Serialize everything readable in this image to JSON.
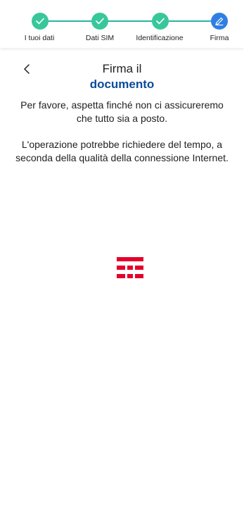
{
  "stepper": {
    "steps": [
      {
        "label": "I tuoi dati",
        "status": "completed",
        "icon": "check-icon"
      },
      {
        "label": "Dati SIM",
        "status": "completed",
        "icon": "check-icon"
      },
      {
        "label": "Identificazione",
        "status": "completed",
        "icon": "check-icon"
      },
      {
        "label": "Firma",
        "status": "active",
        "icon": "pen-icon"
      }
    ],
    "colors": {
      "completed": "#38c79b",
      "active": "#2f7fe3",
      "line": "#2bb3a3"
    }
  },
  "header": {
    "back_icon": "chevron-left-icon",
    "title_line1": "Firma il",
    "title_line2": "documento",
    "title_accent_color": "#0a4b9a"
  },
  "main": {
    "message1": "Per favore, aspetta finché non ci assicureremo che tutto sia a posto.",
    "message2": "L'operazione potrebbe richiedere del tempo, a seconda della qualità della connessione Internet."
  },
  "loader": {
    "icon": "tim-logo-icon",
    "color": "#e4002b"
  }
}
